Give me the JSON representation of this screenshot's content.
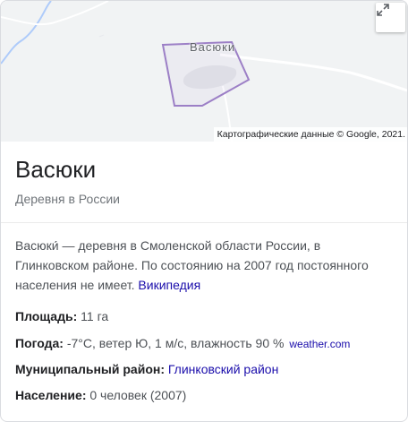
{
  "map": {
    "place_label": "Васюки",
    "attribution": "Картографические данные © Google, 2021.",
    "expand_icon": "expand-icon",
    "colors": {
      "background": "#f1f3f4",
      "boundary": "#9c7fc6",
      "water": "#aecbfa",
      "road": "#ffffff"
    }
  },
  "header": {
    "title": "Васюки",
    "subtitle": "Деревня в России"
  },
  "description": {
    "text": "Васюки́ — деревня в Смоленской области России, в Глинковском районе. По состоянию на 2007 год постоянного населения не имеет. ",
    "source_link": "Википедия"
  },
  "facts": {
    "area": {
      "label": "Площадь:",
      "value": " 11 га"
    },
    "weather": {
      "label": "Погода:",
      "value": " -7°C, ветер Ю, 1 м/с, влажность 90 % ",
      "source": "weather.com"
    },
    "district": {
      "label": "Муниципальный район:",
      "value": "Глинковский район"
    },
    "population": {
      "label": "Население:",
      "value": " 0 человек (2007)"
    }
  }
}
